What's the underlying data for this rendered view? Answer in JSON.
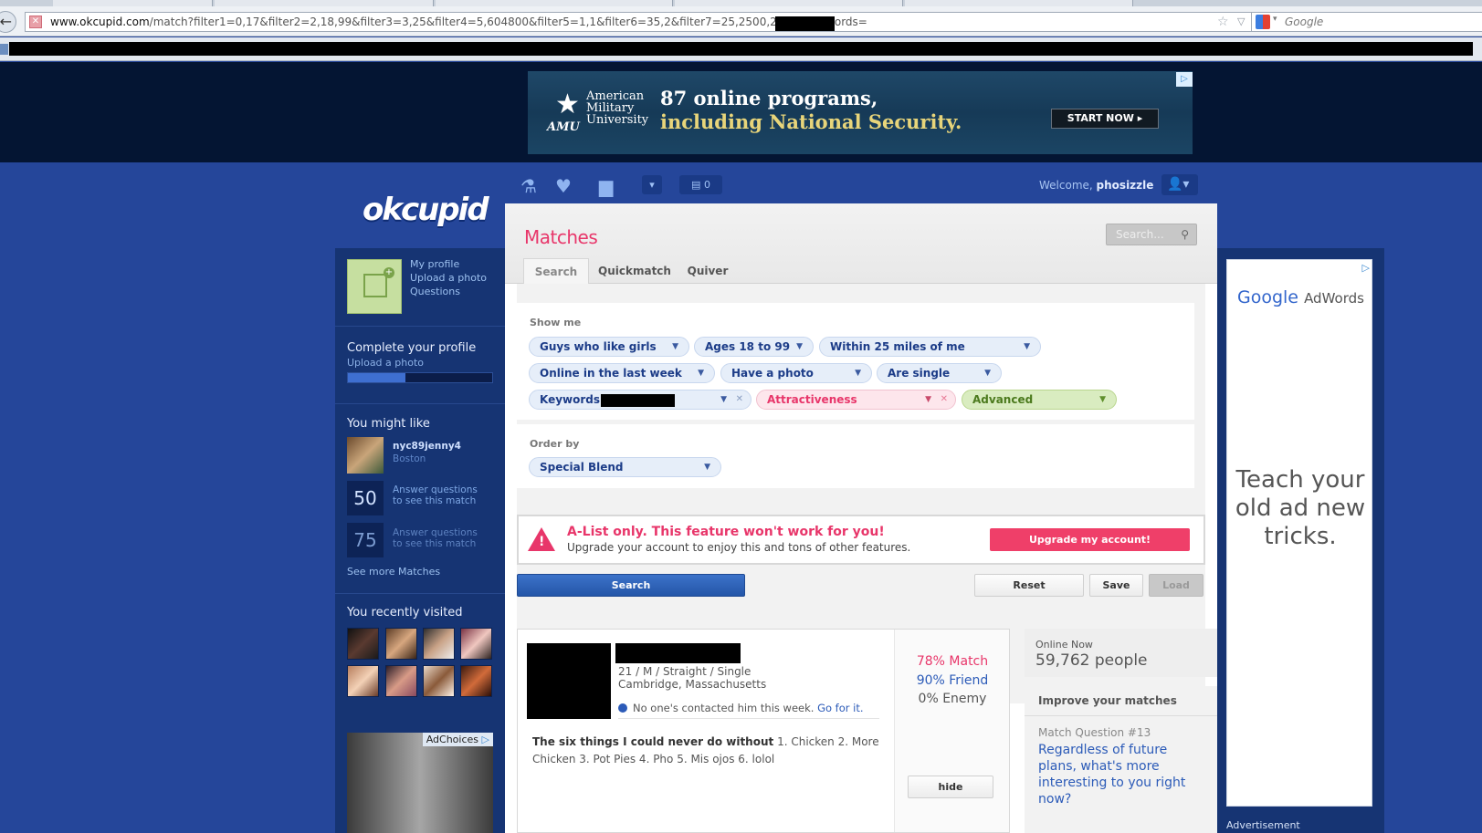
{
  "browser": {
    "url_domain": "www.okcupid.com",
    "url_rest": "/match?filter1=0,17&filter2=2,18,99&filter3=3,25&filter4=5,604800&filter5=1,1&filter6=35,2&filter7=25,2500,2600&keywords=",
    "search_engine_placeholder": "Google"
  },
  "top_ad": {
    "org_line1": "American",
    "org_line2": "Military",
    "org_line3": "University",
    "org_abbr": "AMU",
    "headline1": "87 online programs,",
    "headline2": "including National Security.",
    "cta": "START NOW ▸"
  },
  "nav": {
    "mail_count": "0",
    "welcome_prefix": "Welcome,",
    "username": "phosizzle"
  },
  "logo_text": "okcupid",
  "sidebar": {
    "profile_links": [
      "My profile",
      "Upload a photo",
      "Questions"
    ],
    "complete_title": "Complete your profile",
    "complete_sub": "Upload a photo",
    "profile_progress": 0.4,
    "might_like_title": "You might like",
    "suggested_user": "nyc89jenny4",
    "suggested_location": "Boston",
    "locked_matches": [
      {
        "num": "50",
        "text1": "Answer questions",
        "text2": "to see this match"
      },
      {
        "num": "75",
        "text1": "Answer questions",
        "text2": "to see this match"
      }
    ],
    "see_more": "See more Matches",
    "recent_title": "You recently visited",
    "ad_choices": "AdChoices"
  },
  "main": {
    "title": "Matches",
    "search_placeholder": "Search...",
    "tabs": [
      "Search",
      "Quickmatch",
      "Quiver"
    ],
    "show_me_label": "Show me",
    "filters_row1": [
      "Guys who like girls",
      "Ages 18 to 99",
      "Within 25 miles of me"
    ],
    "filters_row2": [
      "Online in the last week",
      "Have a photo",
      "Are single"
    ],
    "keywords_label": "Keywords:",
    "attractiveness_label": "Attractiveness",
    "advanced_label": "Advanced",
    "order_by_label": "Order by",
    "order_value": "Special Blend",
    "alert_title": "A-List only. This feature won't work for you!",
    "alert_sub": "Upgrade your account to enjoy this and tons of other features.",
    "upgrade_button": "Upgrade my account!",
    "search_button": "Search",
    "reset_button": "Reset",
    "save_button": "Save",
    "load_button": "Load"
  },
  "result": {
    "meta_line1": "21 / M / Straight / Single",
    "meta_line2": "Cambridge, Massachusetts",
    "contact_text": "No one's contacted him this week.",
    "contact_link": "Go for it.",
    "essay_bold": "The six things I could never do without",
    "essay_text": "1. Chicken 2. More Chicken 3. Pot Pies 4. Pho 5. Mis ojos 6. lolol",
    "match": "78% Match",
    "friend": "90% Friend",
    "enemy": "0% Enemy",
    "hide_button": "hide"
  },
  "online_now": {
    "label": "Online Now",
    "value": "59,762 people"
  },
  "improve": {
    "title": "Improve your matches",
    "question_num": "Match Question #13",
    "question_text": "Regardless of future plans, what's more interesting to you right now?"
  },
  "right_ad": {
    "brand": "Google",
    "product": "AdWords",
    "tagline": "Teach your old ad new tricks.",
    "advert_label": "Advertisement"
  },
  "colors": {
    "brand_pink": "#e8366a",
    "link_blue": "#2c5bb8",
    "page_blue": "#25469a"
  }
}
